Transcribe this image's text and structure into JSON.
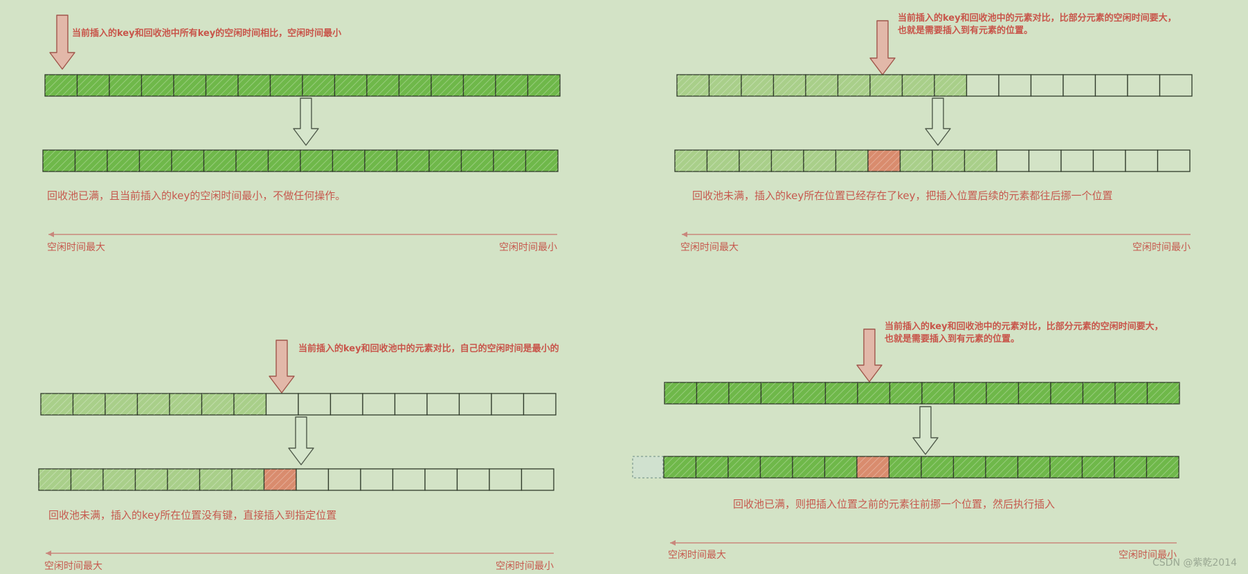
{
  "colors": {
    "background": "#d3e3c6",
    "cell_dark_green": "#6fb84a",
    "cell_light_green": "#a9cf8a",
    "cell_red": "#d98c6e",
    "cell_empty": "#d3e3c6",
    "arrow_red_fill": "#e2b8a9",
    "arrow_green_fill": "#d6e6cc",
    "text_red": "#c6594e"
  },
  "panels": [
    {
      "name": "top-left",
      "note": [
        "当前插入的key和回收池中所有key的空闲时间相比，空闲时间最小"
      ],
      "before_cells": [
        "dark",
        "dark",
        "dark",
        "dark",
        "dark",
        "dark",
        "dark",
        "dark",
        "dark",
        "dark",
        "dark",
        "dark",
        "dark",
        "dark",
        "dark",
        "dark"
      ],
      "after_cells": [
        "dark",
        "dark",
        "dark",
        "dark",
        "dark",
        "dark",
        "dark",
        "dark",
        "dark",
        "dark",
        "dark",
        "dark",
        "dark",
        "dark",
        "dark",
        "dark"
      ],
      "caption": "回收池已满，且当前插入的key的空闲时间最小，不做任何操作。",
      "axis_left": "空闲时间最大",
      "axis_right": "空闲时间最小"
    },
    {
      "name": "top-right",
      "note": [
        "当前插入的key和回收池中的元素对比，比部分元素的空闲时间要大，",
        "也就是需要插入到有元素的位置。"
      ],
      "before_cells": [
        "light",
        "light",
        "light",
        "light",
        "light",
        "light",
        "light",
        "light",
        "light",
        "empty",
        "empty",
        "empty",
        "empty",
        "empty",
        "empty",
        "empty"
      ],
      "after_cells": [
        "light",
        "light",
        "light",
        "light",
        "light",
        "light",
        "red",
        "light",
        "light",
        "light",
        "empty",
        "empty",
        "empty",
        "empty",
        "empty",
        "empty"
      ],
      "caption": "回收池未满，插入的key所在位置已经存在了key，把插入位置后续的元素都往后挪一个位置",
      "axis_left": "空闲时间最大",
      "axis_right": "空闲时间最小"
    },
    {
      "name": "bottom-left",
      "note": [
        "当前插入的key和回收池中的元素对比，自己的空闲时间是最小的"
      ],
      "before_cells": [
        "light",
        "light",
        "light",
        "light",
        "light",
        "light",
        "light",
        "empty",
        "empty",
        "empty",
        "empty",
        "empty",
        "empty",
        "empty",
        "empty",
        "empty"
      ],
      "after_cells": [
        "light",
        "light",
        "light",
        "light",
        "light",
        "light",
        "light",
        "red",
        "empty",
        "empty",
        "empty",
        "empty",
        "empty",
        "empty",
        "empty",
        "empty"
      ],
      "caption": "回收池未满，插入的key所在位置没有键，直接插入到指定位置",
      "axis_left": "空闲时间最大",
      "axis_right": "空闲时间最小"
    },
    {
      "name": "bottom-right",
      "note": [
        "当前插入的key和回收池中的元素对比，比部分元素的空闲时间要大，",
        "也就是需要插入到有元素的位置。"
      ],
      "before_cells": [
        "dark",
        "dark",
        "dark",
        "dark",
        "dark",
        "dark",
        "dark",
        "dark",
        "dark",
        "dark",
        "dark",
        "dark",
        "dark",
        "dark",
        "dark",
        "dark"
      ],
      "after_cells": [
        "dark",
        "dark",
        "dark",
        "dark",
        "dark",
        "dark",
        "red",
        "dark",
        "dark",
        "dark",
        "dark",
        "dark",
        "dark",
        "dark",
        "dark",
        "dark"
      ],
      "caption": "回收池已满，则把插入位置之前的元素往前挪一个位置，然后执行插入",
      "axis_left": "空闲时间最大",
      "axis_right": "空闲时间最小"
    }
  ],
  "watermark": "CSDN @紫乾2014"
}
